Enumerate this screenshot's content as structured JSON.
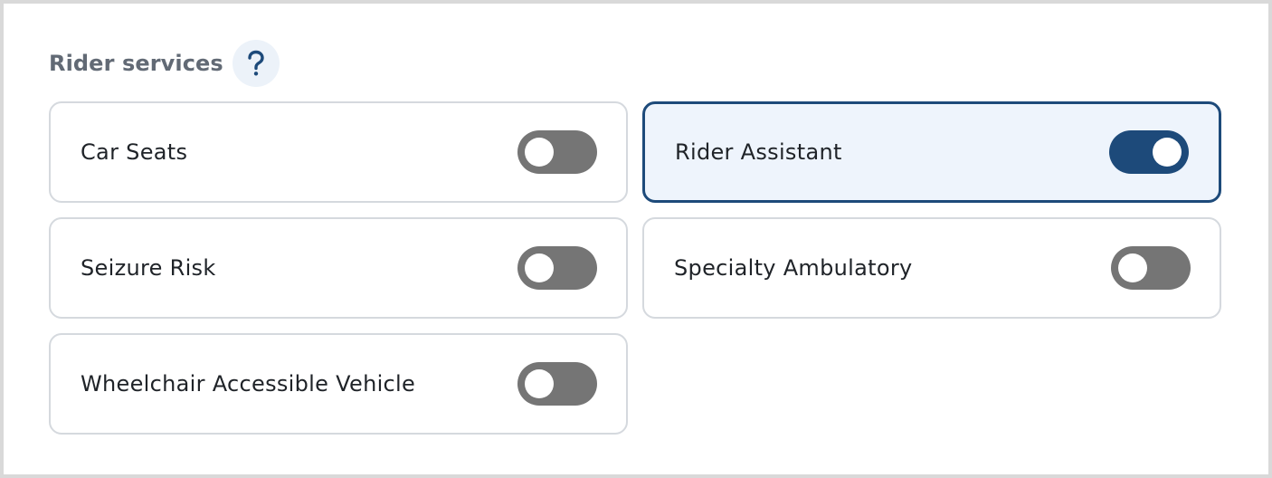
{
  "section": {
    "title": "Rider services",
    "help_icon": "question-mark-icon",
    "help_glyph": "?"
  },
  "services": [
    {
      "label": "Car Seats",
      "enabled": false
    },
    {
      "label": "Rider Assistant",
      "enabled": true
    },
    {
      "label": "Seizure Risk",
      "enabled": false
    },
    {
      "label": "Specialty Ambulatory",
      "enabled": false
    },
    {
      "label": "Wheelchair Accessible Vehicle",
      "enabled": false
    }
  ],
  "colors": {
    "accent": "#1d4a7a",
    "selected_card_bg": "#eef4fc",
    "toggle_off": "#757575",
    "card_border": "#d5d9de",
    "title_text": "#626a75",
    "help_bg": "#ecf2f9"
  }
}
